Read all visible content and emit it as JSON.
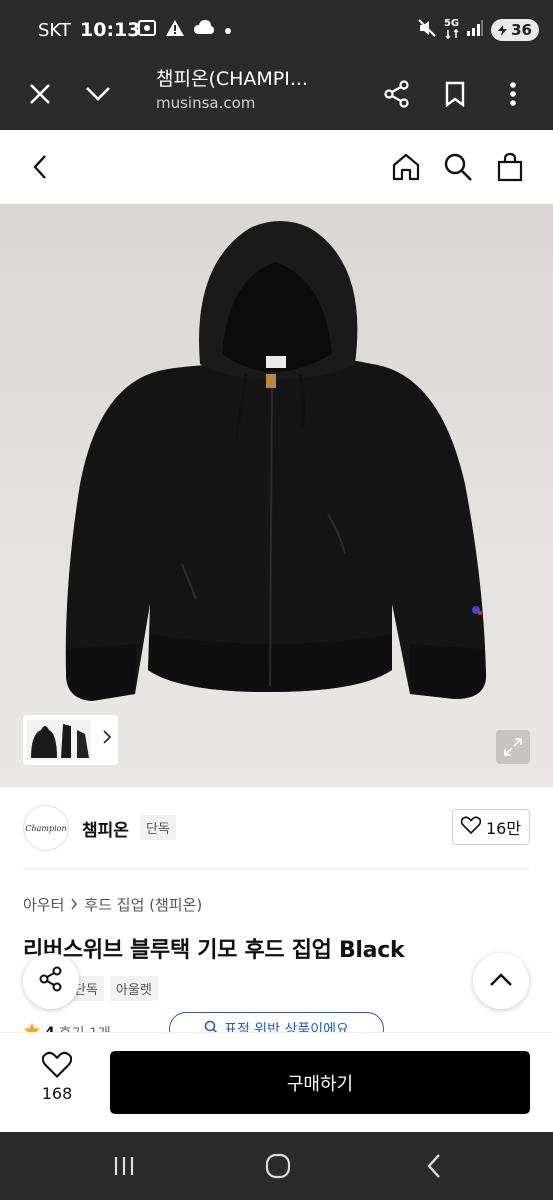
{
  "status_bar": {
    "carrier": "SKT",
    "time": "10:13",
    "network": "5G",
    "battery": "36",
    "icons": [
      "screenshot-icon",
      "warning-icon",
      "cloud-icon",
      "dot-icon",
      "mute-icon",
      "network-5g-icon",
      "signal-icon",
      "battery-icon"
    ]
  },
  "browser": {
    "title": "챔피온(CHAMPI...",
    "url": "musinsa.com",
    "icons": [
      "close-icon",
      "chevron-down-icon",
      "share-icon",
      "bookmark-icon",
      "more-icon"
    ]
  },
  "header": {
    "icons": [
      "back-icon",
      "home-icon",
      "search-icon",
      "cart-icon"
    ]
  },
  "hero": {
    "image_desc": "black zip-up hoodie",
    "icons": [
      "chevron-right-icon",
      "expand-icon"
    ]
  },
  "brand": {
    "logo_text": "Champion",
    "name": "챔피온",
    "exclusive_badge": "단독",
    "like_count": "16만"
  },
  "product": {
    "breadcrumb": [
      "아우터",
      "후드 집업 (챔피온)"
    ],
    "title": "리버스위브 블루택 기모 후드 집업 Black",
    "tags": [
      "단독",
      "아울렛"
    ],
    "rating": "4",
    "review_text": "후기 1개",
    "snap_button": "표적 위반 상품이에요"
  },
  "action_bar": {
    "wish_count": "168",
    "buy_label": "구매하기"
  },
  "colors": {
    "status_bg": "#2b2b2b",
    "buy_button": "#000000",
    "accent_blue": "#1e5bd6",
    "star": "#f5a623"
  }
}
